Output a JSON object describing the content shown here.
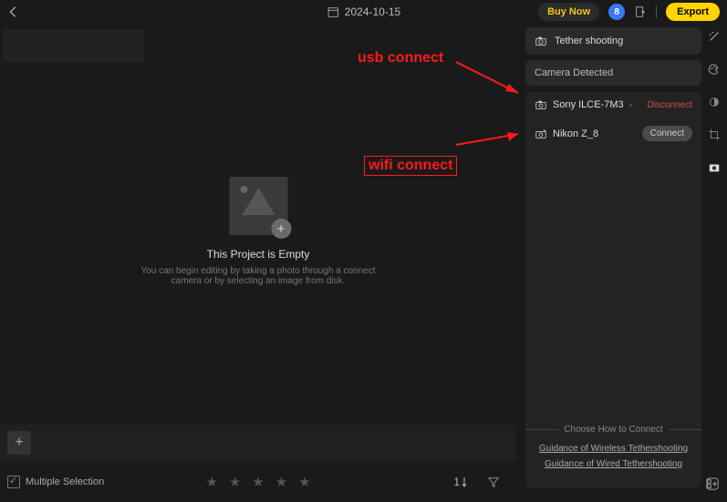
{
  "topbar": {
    "date": "2024-10-15",
    "buy_label": "Buy Now",
    "avatar_initial": "8",
    "export_label": "Export"
  },
  "main": {
    "empty_title": "This Project is Empty",
    "empty_subtitle": "You can begin editing by taking a photo through a connect camera or by selecting an image from disk."
  },
  "panel": {
    "tether_label": "Tether shooting",
    "detected_label": "Camera Detected",
    "cameras": [
      {
        "name": "Sony ILCE-7M3",
        "action": "Disconnect",
        "action_kind": "disconnect"
      },
      {
        "name": "Nikon Z_8",
        "action": "Connect",
        "action_kind": "connect"
      }
    ],
    "how_heading": "Choose How to Connect",
    "link_wireless": "Guidance of Wireless Tethershooting",
    "link_wired": "Guidance of Wired Tethershooting"
  },
  "bottom": {
    "multiple_selection": "Multiple Selection",
    "sort_value": "1"
  },
  "annotations": {
    "usb": "usb connect",
    "wifi": "wifi connect"
  }
}
